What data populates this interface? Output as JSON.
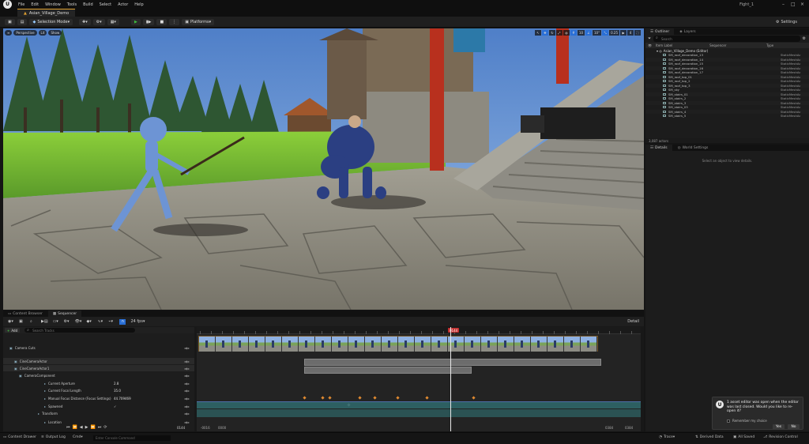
{
  "menubar": {
    "items": [
      "File",
      "Edit",
      "Window",
      "Tools",
      "Build",
      "Select",
      "Actor",
      "Help"
    ],
    "right_label": "Fight_1"
  },
  "project_tab": "Asian_Village_Demo",
  "toolbar": {
    "mode": "Selection Mode",
    "platforms": "Platforms",
    "settings": "Settings"
  },
  "viewport": {
    "left_buttons": [
      "Perspective",
      "Lit",
      "Show"
    ],
    "right_values": [
      "10",
      "10°",
      "0.25",
      "4"
    ]
  },
  "outliner": {
    "tabs": [
      "Outliner",
      "Layers"
    ],
    "search_placeholder": "Search",
    "col_item_label": "Item Label",
    "col_sequencer": "Sequencer",
    "col_type": "Type",
    "root": "Asian_Village_Demo (Editor)",
    "rows": [
      {
        "label": "SM_roof_decoration_13",
        "type": "StaticMeshAc"
      },
      {
        "label": "SM_roof_decoration_14",
        "type": "StaticMeshAc"
      },
      {
        "label": "SM_roof_decoration_15",
        "type": "StaticMeshAc"
      },
      {
        "label": "SM_roof_decoration_16",
        "type": "StaticMeshAc"
      },
      {
        "label": "SM_roof_decoration_17",
        "type": "StaticMeshAc"
      },
      {
        "label": "SM_roof_top_01",
        "type": "StaticMeshAc"
      },
      {
        "label": "SM_roof_top_2",
        "type": "StaticMeshAc"
      },
      {
        "label": "SM_roof_top_3",
        "type": "StaticMeshAc"
      },
      {
        "label": "SM_sky",
        "type": "StaticMeshAc"
      },
      {
        "label": "SM_stairs_01",
        "type": "StaticMeshAc"
      },
      {
        "label": "SM_stairs_2",
        "type": "StaticMeshAc"
      },
      {
        "label": "SM_stairs_3",
        "type": "StaticMeshAc"
      },
      {
        "label": "SM_stairs_03",
        "type": "StaticMeshAc"
      },
      {
        "label": "SM_stairs_4",
        "type": "StaticMeshAc"
      },
      {
        "label": "SM_stairs_5",
        "type": "StaticMeshAc"
      }
    ],
    "actors_count": "3,087 actors"
  },
  "details": {
    "tabs": [
      "Details",
      "World Settings"
    ],
    "hint": "Select an object to view details."
  },
  "bottom_tabs": [
    "Content Browser",
    "Sequencer"
  ],
  "sequencer": {
    "fps": "24 fps",
    "track_label": "Add",
    "search_placeholder": "Search Tracks",
    "tracks": [
      {
        "name": "Camera Cuts",
        "value": ""
      },
      {
        "name": "CineCameraActor",
        "value": ""
      },
      {
        "name": "CineCameraActor1",
        "value": ""
      },
      {
        "name": "CameraComponent",
        "value": ""
      },
      {
        "name": "Current Aperture",
        "value": "2.8"
      },
      {
        "name": "Current Focal Length",
        "value": "35.0"
      },
      {
        "name": "Manual Focus Distance (Focus Settings)",
        "value": "44.709469"
      },
      {
        "name": "Spawned",
        "value": "✓"
      },
      {
        "name": "Transform",
        "value": ""
      },
      {
        "name": "Location",
        "value": ""
      }
    ],
    "playhead_frame": "0144",
    "start_frame": "0000",
    "end_frame": "0144",
    "bottom_left": "-0016",
    "bottom_left2": "0000",
    "bottom_right": "0384",
    "bottom_right2": "0384",
    "right_label": "Detail",
    "ruler_count": "0144"
  },
  "statusbar": {
    "content_drawer": "Content Drawer",
    "output_log": "Output Log",
    "cmd": "Cmd",
    "cmd_placeholder": "Enter Console Command",
    "trace": "Trace",
    "derived_data": "Derived Data",
    "all_saved": "All Saved",
    "revision_control": "Revision Control"
  },
  "toast": {
    "message": "1 asset editor was open when the editor was last closed. Would you like to re-open it?",
    "remember": "Remember my choice",
    "yes": "Yes",
    "no": "No"
  }
}
